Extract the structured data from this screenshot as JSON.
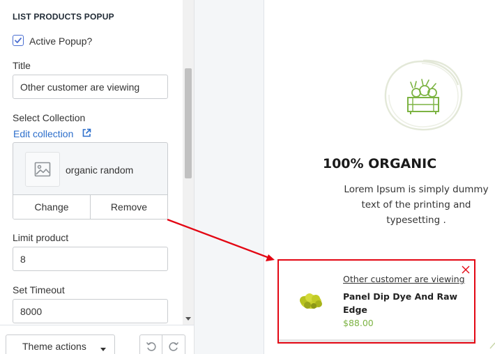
{
  "settings": {
    "section_title": "LIST PRODUCTS POPUP",
    "active_popup": {
      "label": "Active Popup?",
      "checked": true
    },
    "title_field": {
      "label": "Title",
      "value": "Other customer are viewing"
    },
    "collection": {
      "label": "Select Collection",
      "edit_link": "Edit collection",
      "name": "organic random",
      "change_label": "Change",
      "remove_label": "Remove"
    },
    "limit_field": {
      "label": "Limit product",
      "value": "8"
    },
    "timeout_field": {
      "label": "Set Timeout",
      "value": "8000"
    }
  },
  "toolbar": {
    "theme_actions_label": "Theme actions"
  },
  "preview": {
    "organic_title": "100% ORGANIC",
    "organic_description": "Lorem Ipsum is simply dummy text of the printing and typesetting .",
    "popup": {
      "viewing_text": "Other customer are viewing",
      "product_name": "Panel Dip Dye And Raw Edge",
      "price": "$88.00"
    }
  },
  "colors": {
    "accent_link": "#2c6ecb",
    "checkbox": "#4a6ed1",
    "highlight_border": "#e30613",
    "price_green": "#7cb342",
    "badge_green": "#7cb342"
  },
  "icons": [
    "check-icon",
    "external-link-icon",
    "image-placeholder-icon",
    "caret-down-icon",
    "undo-icon",
    "redo-icon",
    "vegetable-crate-icon",
    "close-icon"
  ]
}
